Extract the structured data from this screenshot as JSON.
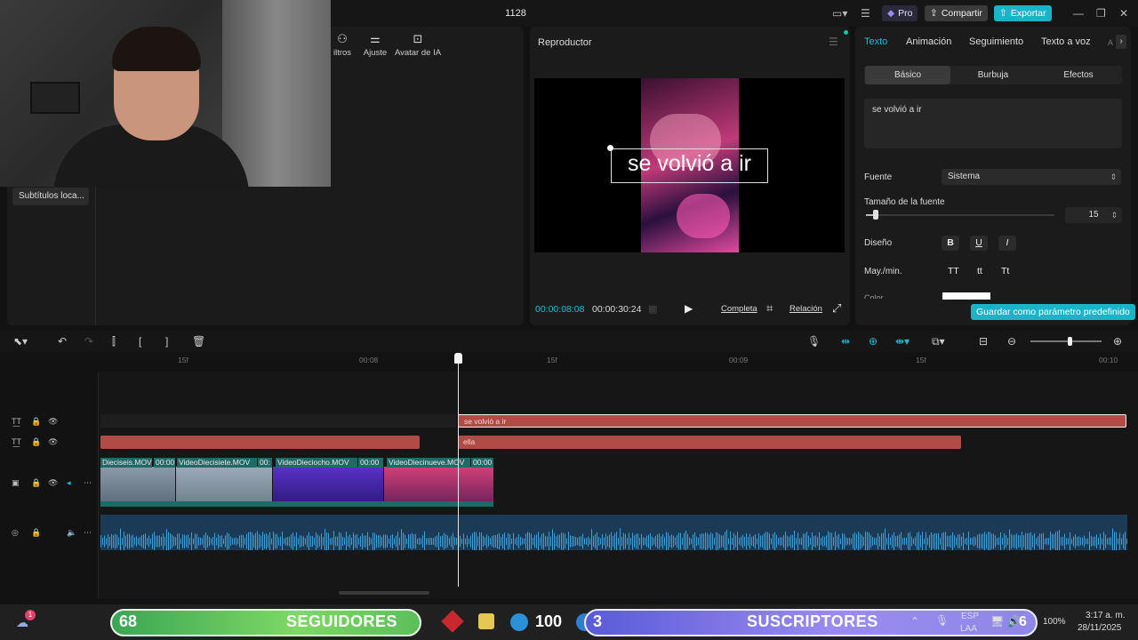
{
  "window": {
    "project_title": "1128",
    "pro": "Pro",
    "share": "Compartir",
    "export": "Exportar"
  },
  "media": {
    "tools": [
      {
        "label": "iltros"
      },
      {
        "label": "Ajuste"
      },
      {
        "label": "Avatar de IA"
      }
    ],
    "subtitle_chip": "Subtítulos loca..."
  },
  "player": {
    "title": "Reproductor",
    "caption": "se volvió a ir",
    "current_time": "00:00:08:08",
    "total_time": "00:00:30:24",
    "full": "Completa",
    "ratio": "Relación"
  },
  "props": {
    "tabs": [
      "Texto",
      "Animación",
      "Seguimiento",
      "Texto a voz",
      "A"
    ],
    "subtabs": [
      "Básico",
      "Burbuja",
      "Efectos"
    ],
    "text_value": "se volvió a ir",
    "font_label": "Fuente",
    "font_value": "Sistema",
    "size_label": "Tamaño de la fuente",
    "size_value": "15",
    "size_fraction": 0.04,
    "style_label": "Diseño",
    "style_buttons": [
      "B",
      "U",
      "I"
    ],
    "case_label": "May./min.",
    "case_buttons": [
      "TT",
      "tt",
      "Tt"
    ],
    "color_label": "Color",
    "color_value": "#ffffff",
    "save_preset": "Guardar como parámetro predefinido",
    "accent": "#19b4c8"
  },
  "timeline": {
    "ruler": [
      "15f",
      "00:08",
      "15f",
      "00:09",
      "15f",
      "00:10"
    ],
    "text_clips": [
      "se volvió a ir",
      "ella"
    ],
    "video_clips": [
      "Dieciseis.MOV",
      "00:00",
      "VideoDiecisiete.MOV",
      "00:",
      "VideoDieciocho.MOV",
      "00:00",
      "VideoDiecinueve.MOV",
      "00:00"
    ]
  },
  "taskbar": {
    "notif_count": "1",
    "followers_count": "68",
    "followers_label": "SEGUIDORES",
    "app_count": "100",
    "subscribers_count": "3",
    "subscribers_label": "SUSCRIPTORES",
    "lang": "ESP",
    "lang2": "LAA",
    "badge": "6",
    "battery": "100%",
    "time": "3:17 a. m.",
    "date": "28/11/2025"
  }
}
